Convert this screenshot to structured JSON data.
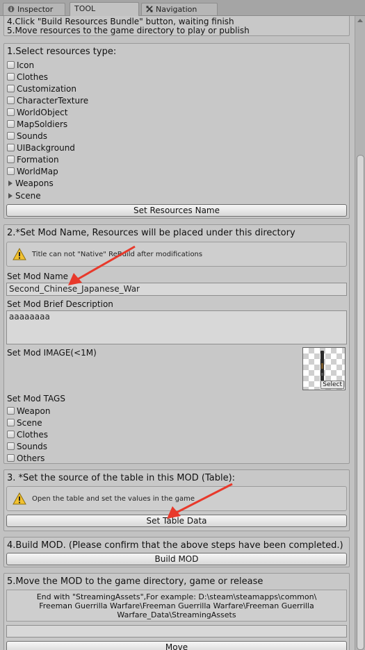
{
  "tabs": [
    {
      "label": "Inspector",
      "icon": "info-icon"
    },
    {
      "label": "TOOL",
      "icon": ""
    },
    {
      "label": "Navigation",
      "icon": "navigation-icon"
    }
  ],
  "step_intro": {
    "line4": "4.Click \"Build Resources Bundle\" button, waiting finish",
    "line5": "5.Move resources to the game directory to play or publish"
  },
  "step1": {
    "title": "1.Select resources type:",
    "checkboxes": [
      "Icon",
      "Clothes",
      "Customization",
      "CharacterTexture",
      "WorldObject",
      "MapSoldiers",
      "Sounds",
      "UIBackground",
      "Formation",
      "WorldMap"
    ],
    "foldouts": [
      "Weapons",
      "Scene"
    ],
    "button": "Set Resources Name"
  },
  "step2": {
    "title": "2.*Set Mod Name, Resources will be placed under this directory",
    "help": "Title can not \"Native\" ReBuild after modifications",
    "name_label": "Set Mod Name",
    "name_value": "Second_Chinese_Japanese_War",
    "desc_label": "Set Mod Brief Description",
    "desc_value": "aaaaaaaa",
    "image_label": "Set Mod IMAGE(<1M)",
    "image_select": "Select",
    "tags_label": "Set Mod TAGS",
    "tags": [
      "Weapon",
      "Scene",
      "Clothes",
      "Sounds",
      "Others"
    ]
  },
  "step3": {
    "title": "3. *Set the source of the table in this MOD (Table):",
    "help": "Open the table and set the values in the game",
    "button": "Set Table Data"
  },
  "step4": {
    "title": "4.Build MOD. (Please confirm that the above steps have been completed.)",
    "button": "Build MOD"
  },
  "step5": {
    "title": "5.Move the MOD to the game directory, game or release",
    "path_hint": "End with \"StreamingAssets\",For example: D:\\steam\\steamapps\\common\\ Freeman Guerrilla Warfare\\Freeman Guerrilla Warfare\\Freeman Guerrilla Warfare_Data\\StreamingAssets",
    "path_value": "",
    "button": "Move"
  },
  "colors": {
    "annotation_arrow": "#e8392b",
    "panel_bg": "#c2c2c2",
    "warning": "#f2c12e"
  }
}
